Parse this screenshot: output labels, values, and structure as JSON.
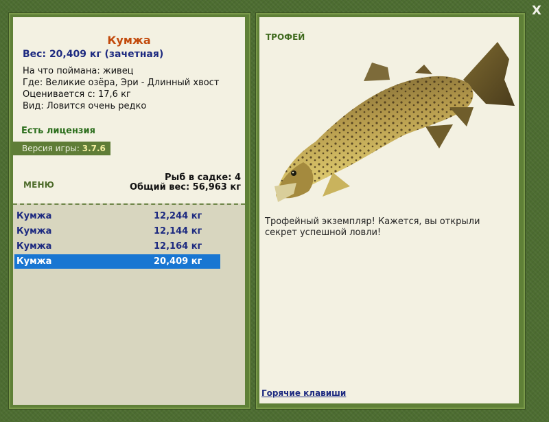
{
  "window": {
    "close_label": "X"
  },
  "left_panel": {
    "fish_name": "Кумжа",
    "weight_line": "Вес: 20,409 кг (зачетная)",
    "caught_on": "На что поймана: живец",
    "location": "Где: Великие озёра, Эри - Длинный хвост",
    "rated_from": "Оценивается с: 17,6 кг",
    "species": "Вид: Ловится очень редко",
    "license": "Есть лицензия",
    "version_label": "Версия игры: ",
    "version_value": "3.7.6",
    "menu_label": "МЕНЮ",
    "fish_in_keepnet": "Рыб в садке: 4",
    "total_weight": "Общий вес: 56,963 кг",
    "catch_list": [
      {
        "name": "Кумжа",
        "weight": "12,244 кг",
        "selected": false
      },
      {
        "name": "Кумжа",
        "weight": "12,144 кг",
        "selected": false
      },
      {
        "name": "Кумжа",
        "weight": "12,164 кг",
        "selected": false
      },
      {
        "name": "Кумжа",
        "weight": "20,409 кг",
        "selected": true
      }
    ]
  },
  "right_panel": {
    "title": "ТРОФЕЙ",
    "trophy_text": "Трофейный экземпляр! Кажется, вы открыли секрет успешной ловли!",
    "hotkeys_link": "Горячие клавиши",
    "fish_image_icon": "brown-trout-image"
  },
  "colors": {
    "background": "#4d6d31",
    "panel": "#f3f1e2",
    "list_bg": "#d8d6bf",
    "selected_row": "#1876d2",
    "fish_name_color": "#c24a0c",
    "link_color": "#1d2a80"
  }
}
